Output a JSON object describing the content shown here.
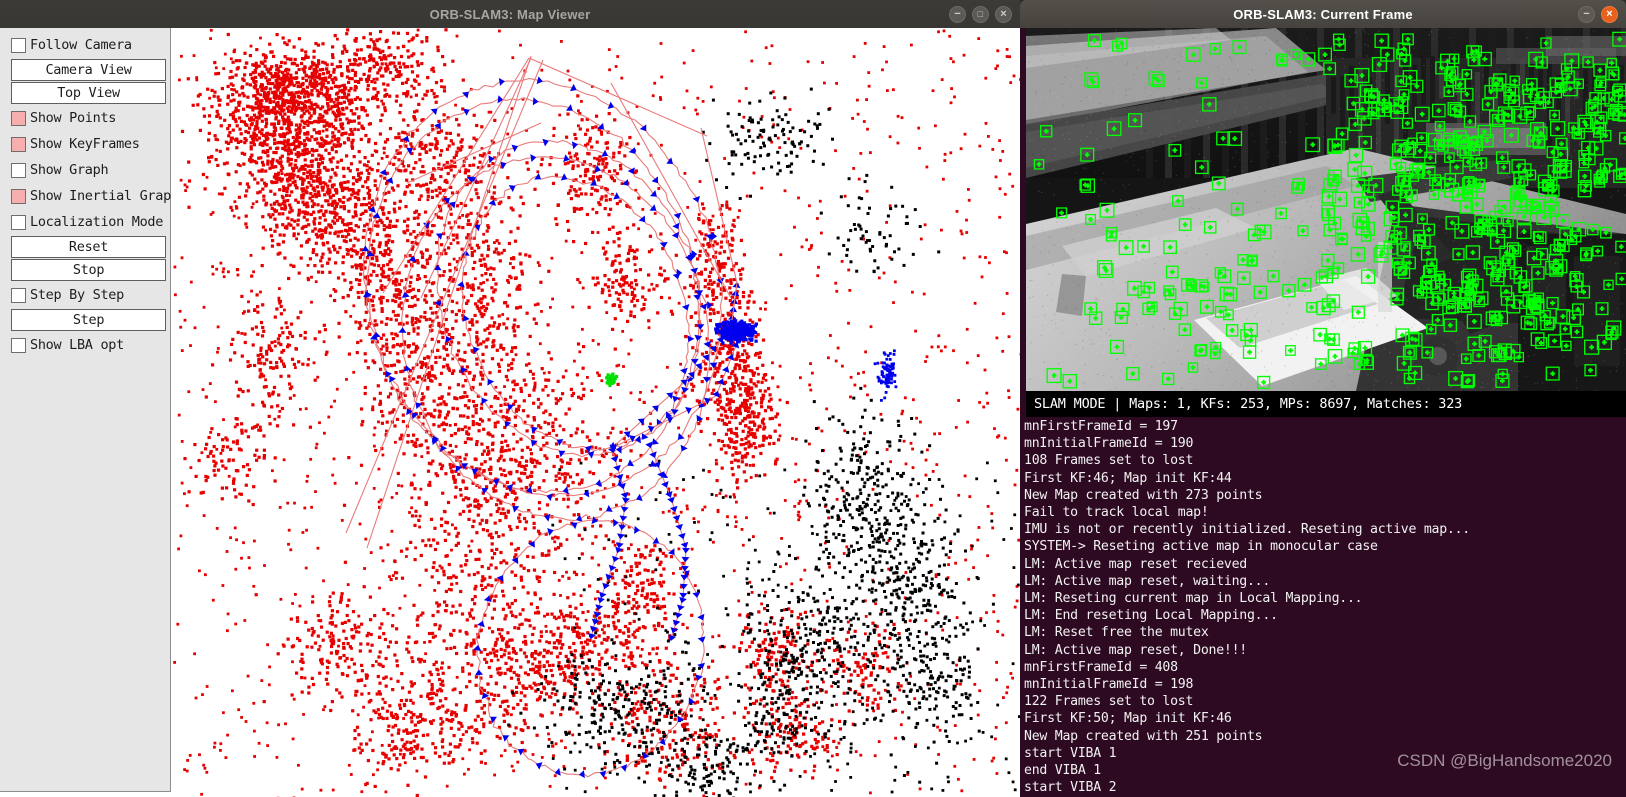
{
  "map_window": {
    "title": "ORB-SLAM3: Map Viewer",
    "active": false,
    "window_buttons": {
      "minimize": "−",
      "maximize": "□",
      "close": "×"
    },
    "sidebar": {
      "controls": [
        {
          "kind": "checkbox",
          "label": "Follow Camera",
          "checked": false,
          "name": "follow-camera"
        },
        {
          "kind": "button",
          "label": "Camera View",
          "name": "camera-view"
        },
        {
          "kind": "button",
          "label": "Top View",
          "name": "top-view"
        },
        {
          "kind": "checkbox",
          "label": "Show Points",
          "checked": true,
          "name": "show-points"
        },
        {
          "kind": "checkbox",
          "label": "Show KeyFrames",
          "checked": true,
          "name": "show-keyframes"
        },
        {
          "kind": "checkbox",
          "label": "Show Graph",
          "checked": false,
          "name": "show-graph"
        },
        {
          "kind": "checkbox",
          "label": "Show Inertial Graph",
          "checked": true,
          "name": "show-inertial-graph"
        },
        {
          "kind": "checkbox",
          "label": "Localization Mode",
          "checked": false,
          "name": "localization-mode"
        },
        {
          "kind": "button",
          "label": "Reset",
          "name": "reset"
        },
        {
          "kind": "button",
          "label": "Stop",
          "name": "stop"
        },
        {
          "kind": "checkbox",
          "label": "Step By Step",
          "checked": false,
          "name": "step-by-step"
        },
        {
          "kind": "button",
          "label": "Step",
          "name": "step"
        },
        {
          "kind": "checkbox",
          "label": "Show LBA opt",
          "checked": false,
          "name": "show-lba-opt"
        }
      ]
    },
    "colors": {
      "map_point": "#e60000",
      "map_point_old": "#000000",
      "keyframe": "#0000ee",
      "graph_edge": "#e87a7a",
      "current_camera": "#00e000",
      "background": "#ffffff"
    }
  },
  "frame_window": {
    "title": "ORB-SLAM3: Current Frame",
    "active": true,
    "window_buttons": {
      "minimize": "−",
      "close": "×"
    },
    "feature_color": "#00ff00",
    "status": "SLAM MODE |  Maps: 1, KFs: 253, MPs: 8697, Matches: 323",
    "status_fields": {
      "mode": "SLAM MODE",
      "maps": 1,
      "kfs": 253,
      "mps": 8697,
      "matches": 323
    },
    "terminal_lines": [
      "mnFirstFrameId = 197",
      "mnInitialFrameId = 190",
      "108 Frames set to lost",
      "First KF:46; Map init KF:44",
      "New Map created with 273 points",
      "Fail to track local map!",
      "IMU is not or recently initialized. Reseting active map...",
      "SYSTEM-> Reseting active map in monocular case",
      "LM: Active map reset recieved",
      "LM: Active map reset, waiting...",
      "LM: Reseting current map in Local Mapping...",
      "LM: End reseting Local Mapping...",
      "LM: Reset free the mutex",
      "LM: Active map reset, Done!!!",
      "mnFirstFrameId = 408",
      "mnInitialFrameId = 198",
      "122 Frames set to lost",
      "First KF:50; Map init KF:46",
      "New Map created with 251 points",
      "start VIBA 1",
      "end VIBA 1",
      "start VIBA 2"
    ],
    "watermark": "CSDN @BigHandsome2020"
  }
}
